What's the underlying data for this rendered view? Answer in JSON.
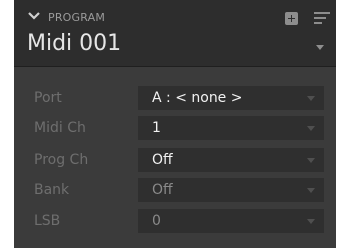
{
  "section": {
    "title": "PROGRAM"
  },
  "program": {
    "name": "Midi 001"
  },
  "icons": {
    "collapse": "chevron-down-icon",
    "add": "plus-icon",
    "menu": "hamburger-icon",
    "dropdown": "chevron-down-icon"
  },
  "params": [
    {
      "label": "Port",
      "value": "A : < none >",
      "active": true
    },
    {
      "label": "Midi Ch",
      "value": "1",
      "active": true
    },
    {
      "label": "Prog Ch",
      "value": "Off",
      "active": true
    },
    {
      "label": "Bank",
      "value": "Off",
      "active": false
    },
    {
      "label": "LSB",
      "value": "0",
      "active": false
    }
  ],
  "colors": {
    "active_value": "#f2f2f2",
    "inactive_value": "#8a8a8a"
  }
}
